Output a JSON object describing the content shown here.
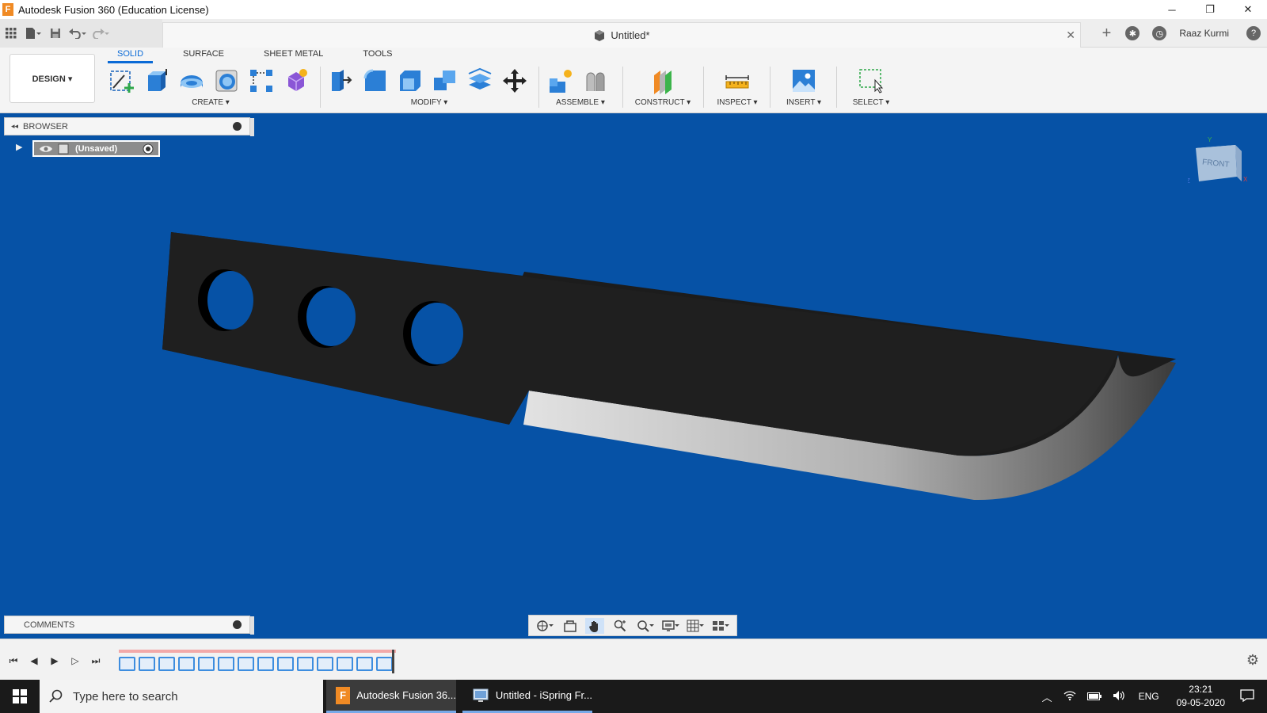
{
  "window": {
    "title": "Autodesk Fusion 360 (Education License)",
    "logo_letter": "F",
    "controls": {
      "minimize": "─",
      "restore": "❐",
      "close": "✕"
    }
  },
  "quick_access": {
    "doc_title": "Untitled*",
    "doc_close": "✕",
    "user_name": "Raaz Kurmi",
    "add_tab": "+",
    "help": "?"
  },
  "toolbar": {
    "workspace": "DESIGN ▾",
    "tabs": [
      "SOLID",
      "SURFACE",
      "SHEET METAL",
      "TOOLS"
    ],
    "groups": {
      "create": "CREATE ▾",
      "modify": "MODIFY ▾",
      "assemble": "ASSEMBLE ▾",
      "construct": "CONSTRUCT ▾",
      "inspect": "INSPECT ▾",
      "insert": "INSERT ▾",
      "select": "SELECT ▾"
    }
  },
  "browser": {
    "label": "BROWSER",
    "collapse_icon": "◂◂",
    "root_node": "(Unsaved)",
    "expand_arrow": "▶"
  },
  "comments": {
    "label": "COMMENTS"
  },
  "viewcube": {
    "face": "FRONT",
    "axis_y": "Y",
    "axis_x": "X",
    "axis_z": "Z"
  },
  "timeline": {
    "controls": [
      "⏮",
      "◀",
      "▶",
      "▷",
      "⏭"
    ],
    "settings": "⚙",
    "feature_count": 14
  },
  "taskbar": {
    "search_placeholder": "Type here to search",
    "apps": [
      {
        "label": "Autodesk Fusion 36...",
        "icon_letter": "F"
      },
      {
        "label": "Untitled - iSpring Fr..."
      }
    ],
    "language": "ENG",
    "time": "23:21",
    "date": "09-05-2020"
  },
  "colors": {
    "viewport_bg": "#0652a6",
    "accent": "#0a6ad6",
    "knife_body": "#1e1e1e",
    "edge_gray": "#8f8f8f"
  }
}
